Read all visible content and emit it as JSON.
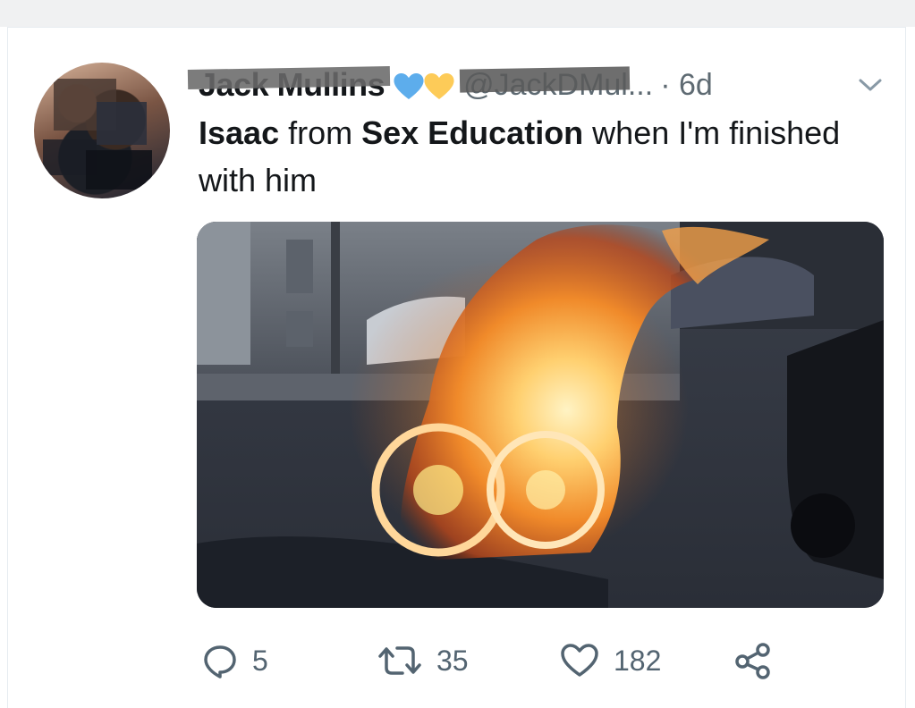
{
  "tweet": {
    "author_name": "Jack Mullins",
    "author_emojis": [
      "blue-heart",
      "yellow-heart"
    ],
    "handle": "@JackDMul...",
    "separator": "·",
    "time": "6d",
    "text_parts": [
      {
        "text": "Isaac",
        "bold": true
      },
      {
        "text": " from ",
        "bold": false
      },
      {
        "text": "Sex Education",
        "bold": true
      },
      {
        "text": " when I'm finished with him",
        "bold": false
      }
    ],
    "media": {
      "type": "photo",
      "subject": "burning-wheelchair-on-street"
    },
    "actions": {
      "reply_count": "5",
      "retweet_count": "35",
      "like_count": "182"
    }
  },
  "icons": {
    "reply": "reply-icon",
    "retweet": "retweet-icon",
    "like": "heart-outline-icon",
    "share": "share-icon",
    "caret": "chevron-down-icon"
  },
  "colors": {
    "text": "#14171a",
    "secondary": "#5e6a72",
    "blue_heart": "#5dadec",
    "yellow_heart": "#fdcb58"
  }
}
